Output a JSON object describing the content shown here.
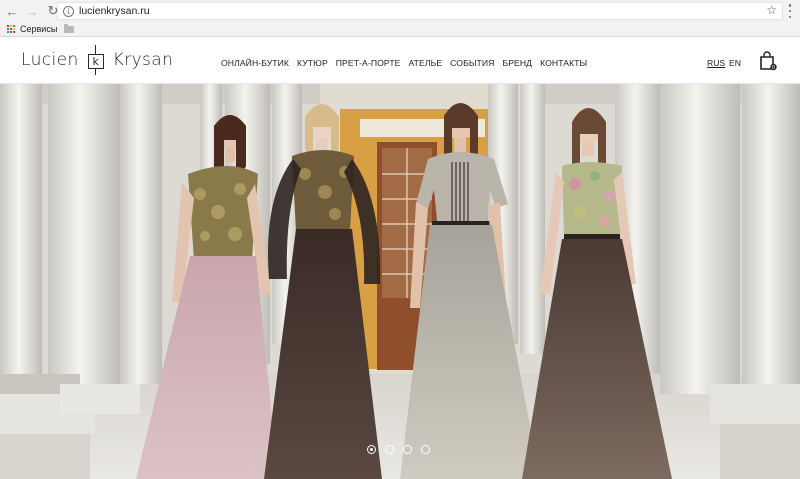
{
  "browser": {
    "url": "lucienkrysan.ru",
    "bookmarks": [
      {
        "label": "Сервисы"
      }
    ]
  },
  "site": {
    "logo": {
      "left": "Lucien",
      "mark": "k",
      "right": "Krysan"
    },
    "nav": [
      {
        "label": "ОНЛАЙН-БУТИК"
      },
      {
        "label": "КУТЮР"
      },
      {
        "label": "ПРЕТ-А-ПОРТЕ"
      },
      {
        "label": "АТЕЛЬЕ"
      },
      {
        "label": "СОБЫТИЯ"
      },
      {
        "label": "БРЕНД"
      },
      {
        "label": "КОНТАКТЫ"
      }
    ],
    "languages": {
      "current": "RUS",
      "other": "EN"
    }
  },
  "hero": {
    "slide_count": 4,
    "active_slide": 1
  },
  "colors": {
    "nav_text": "#222222",
    "chrome_bg": "#f2f2f2"
  }
}
